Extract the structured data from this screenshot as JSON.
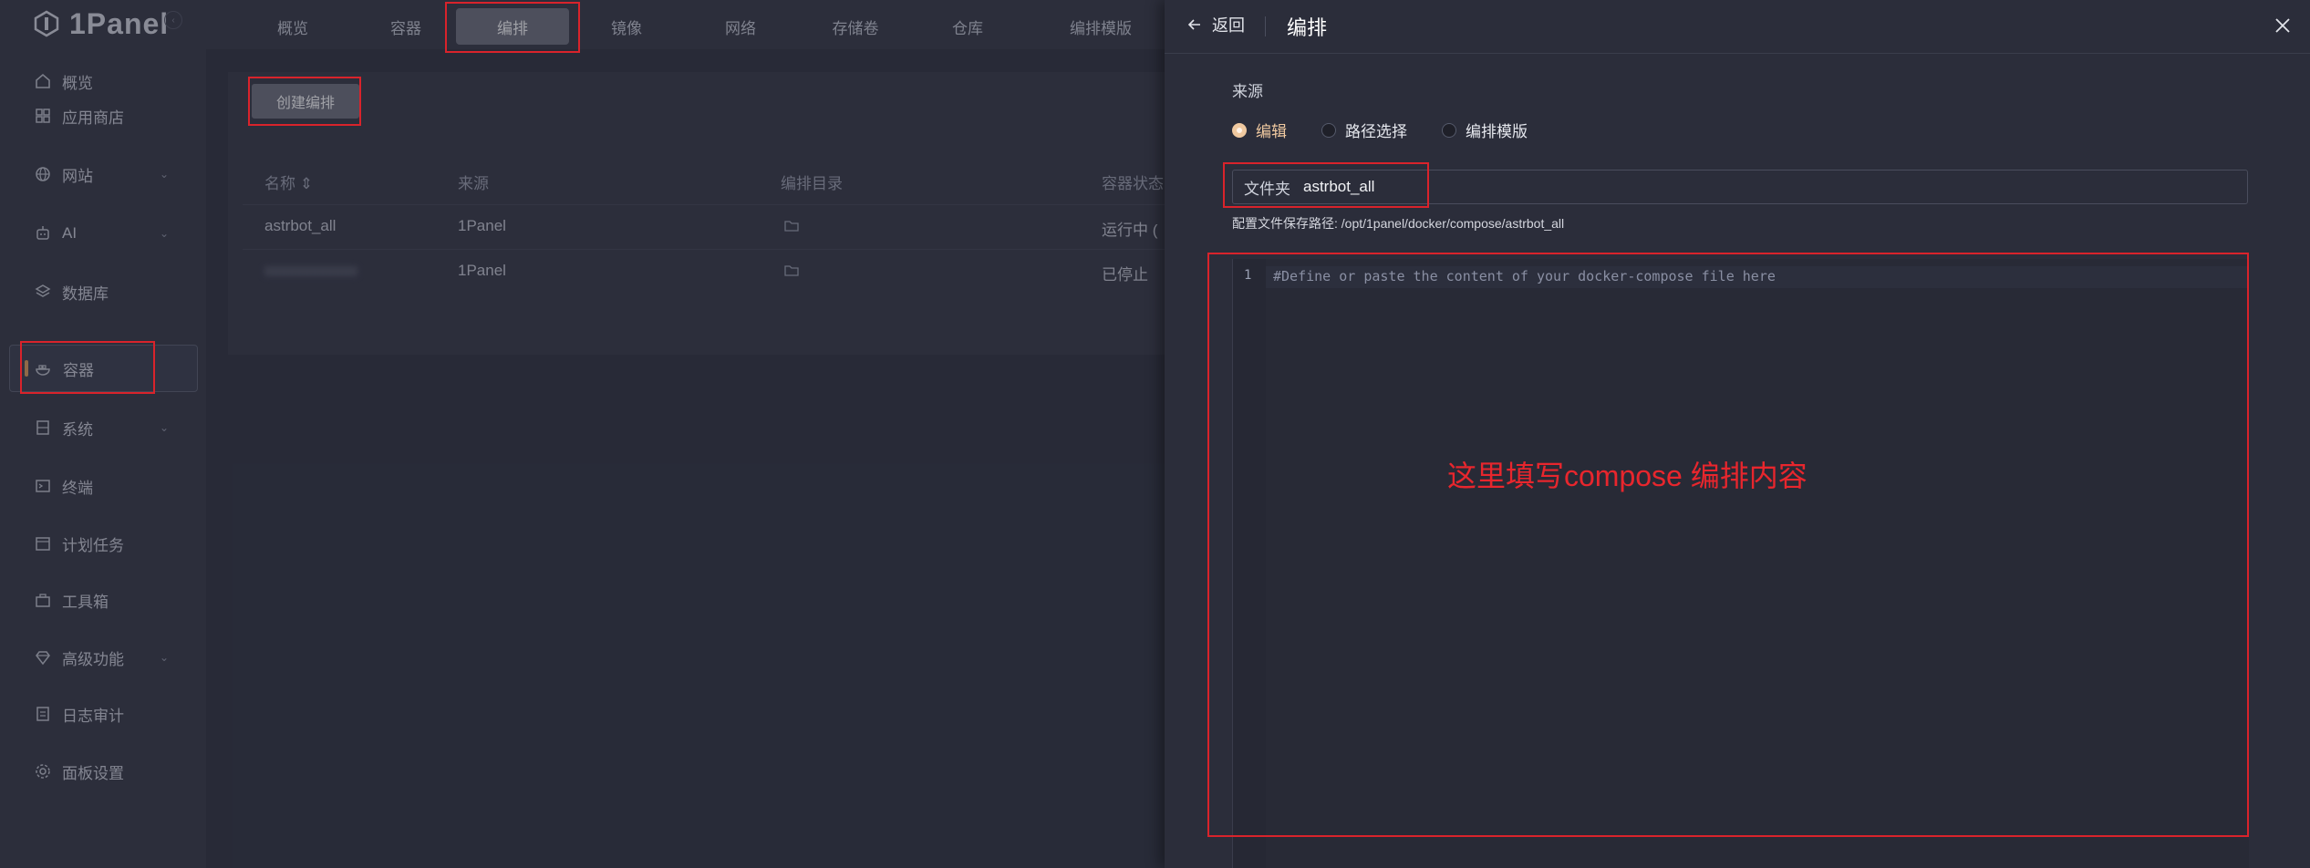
{
  "brand": {
    "name": "1Panel"
  },
  "sidebar": {
    "items": [
      {
        "label": "概览",
        "icon": "home-icon"
      },
      {
        "label": "应用商店",
        "icon": "grid-icon"
      },
      {
        "label": "网站",
        "icon": "globe-icon",
        "expandable": true
      },
      {
        "label": "AI",
        "icon": "robot-icon",
        "expandable": true
      },
      {
        "label": "数据库",
        "icon": "layers-icon"
      },
      {
        "label": "容器",
        "icon": "docker-icon",
        "active": true
      },
      {
        "label": "系统",
        "icon": "server-icon",
        "expandable": true
      },
      {
        "label": "终端",
        "icon": "terminal-icon"
      },
      {
        "label": "计划任务",
        "icon": "calendar-icon"
      },
      {
        "label": "工具箱",
        "icon": "toolbox-icon"
      },
      {
        "label": "高级功能",
        "icon": "diamond-icon",
        "expandable": true
      },
      {
        "label": "日志审计",
        "icon": "log-icon"
      },
      {
        "label": "面板设置",
        "icon": "gear-icon"
      }
    ]
  },
  "tabs": [
    {
      "label": "概览"
    },
    {
      "label": "容器"
    },
    {
      "label": "编排",
      "active": true
    },
    {
      "label": "镜像"
    },
    {
      "label": "网络"
    },
    {
      "label": "存储卷"
    },
    {
      "label": "仓库"
    },
    {
      "label": "编排模版"
    }
  ],
  "main": {
    "create_button": "创建编排",
    "columns": [
      "名称",
      "来源",
      "编排目录",
      "容器状态"
    ],
    "rows": [
      {
        "name": "astrbot_all",
        "source": "1Panel",
        "status": "运行中 ("
      },
      {
        "name": "xxxxxxxxxxxx",
        "source": "1Panel",
        "status": "已停止"
      }
    ]
  },
  "drawer": {
    "back_label": "返回",
    "title": "编排",
    "source_label": "来源",
    "source_options": [
      {
        "label": "编辑",
        "selected": true
      },
      {
        "label": "路径选择",
        "selected": false
      },
      {
        "label": "编排模版",
        "selected": false
      }
    ],
    "folder_prefix": "文件夹",
    "folder_value": "astrbot_all",
    "path_hint": "配置文件保存路径: /opt/1panel/docker/compose/astrbot_all",
    "editor": {
      "line_number": "1",
      "placeholder": "#Define or paste the content of your docker-compose file here"
    }
  },
  "annotation": {
    "text": "这里填写compose 编排内容"
  },
  "colors": {
    "accent": "#e09b55",
    "highlight": "#d9232b",
    "radio": "#f0c9a0"
  }
}
